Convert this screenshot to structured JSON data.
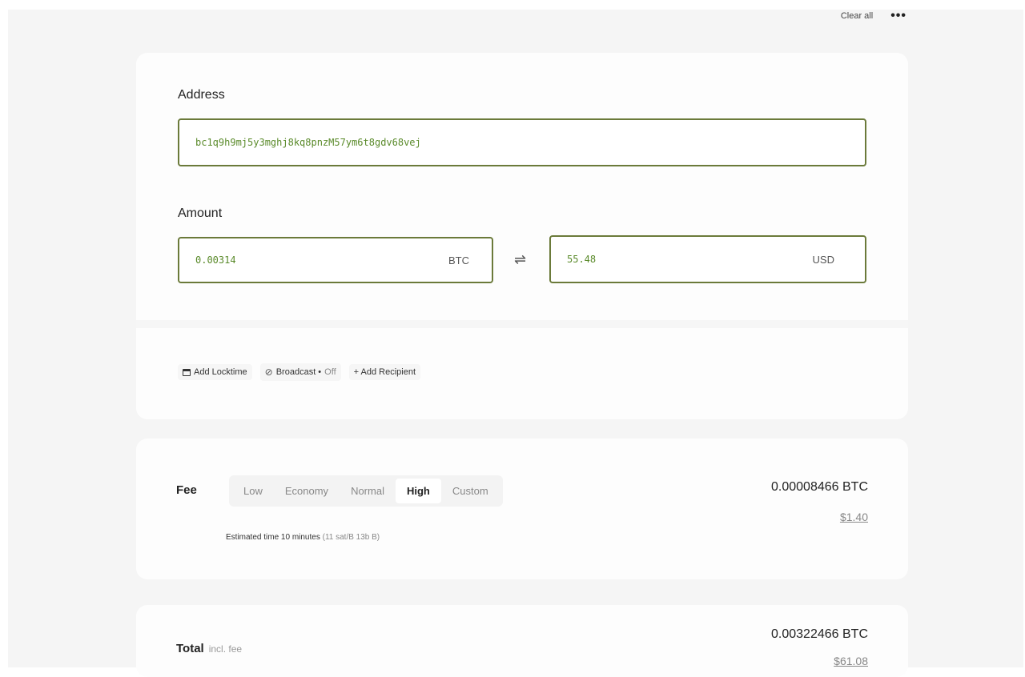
{
  "header": {
    "clear_all_label": "Clear all",
    "more_label": "•••"
  },
  "recipient": {
    "address_label": "Address",
    "address_value": "bc1q9h9mj5y3mghj8kq8pnzM57ym6t8gdv68vej",
    "amount_label": "Amount",
    "amount_btc": "0.00314",
    "unit_btc": "BTC",
    "amount_usd": "55.48",
    "unit_usd": "USD",
    "swap_icon": "⇌",
    "options": {
      "add_locktime_label": "Add Locktime",
      "broadcast_label": "Broadcast •",
      "broadcast_state": "Off",
      "add_recipient_label": "+ Add Recipient"
    }
  },
  "fee": {
    "label": "Fee",
    "tabs": [
      {
        "label": "Low",
        "active": false
      },
      {
        "label": "Economy",
        "active": false
      },
      {
        "label": "Normal",
        "active": false
      },
      {
        "label": "High",
        "active": true
      },
      {
        "label": "Custom",
        "active": false
      }
    ],
    "btc": "0.00008466 BTC",
    "usd": "$1.40",
    "estimate_text": "Estimated time 10 minutes",
    "estimate_rate": "(11 sat/B 13b B)"
  },
  "total": {
    "label": "Total",
    "sub_label": "incl. fee",
    "btc": "0.00322466 BTC",
    "usd": "$61.08"
  },
  "colors": {
    "accent_border": "#6b7a3a",
    "value_text": "#5a8a2a",
    "background": "#f5f5f5"
  }
}
